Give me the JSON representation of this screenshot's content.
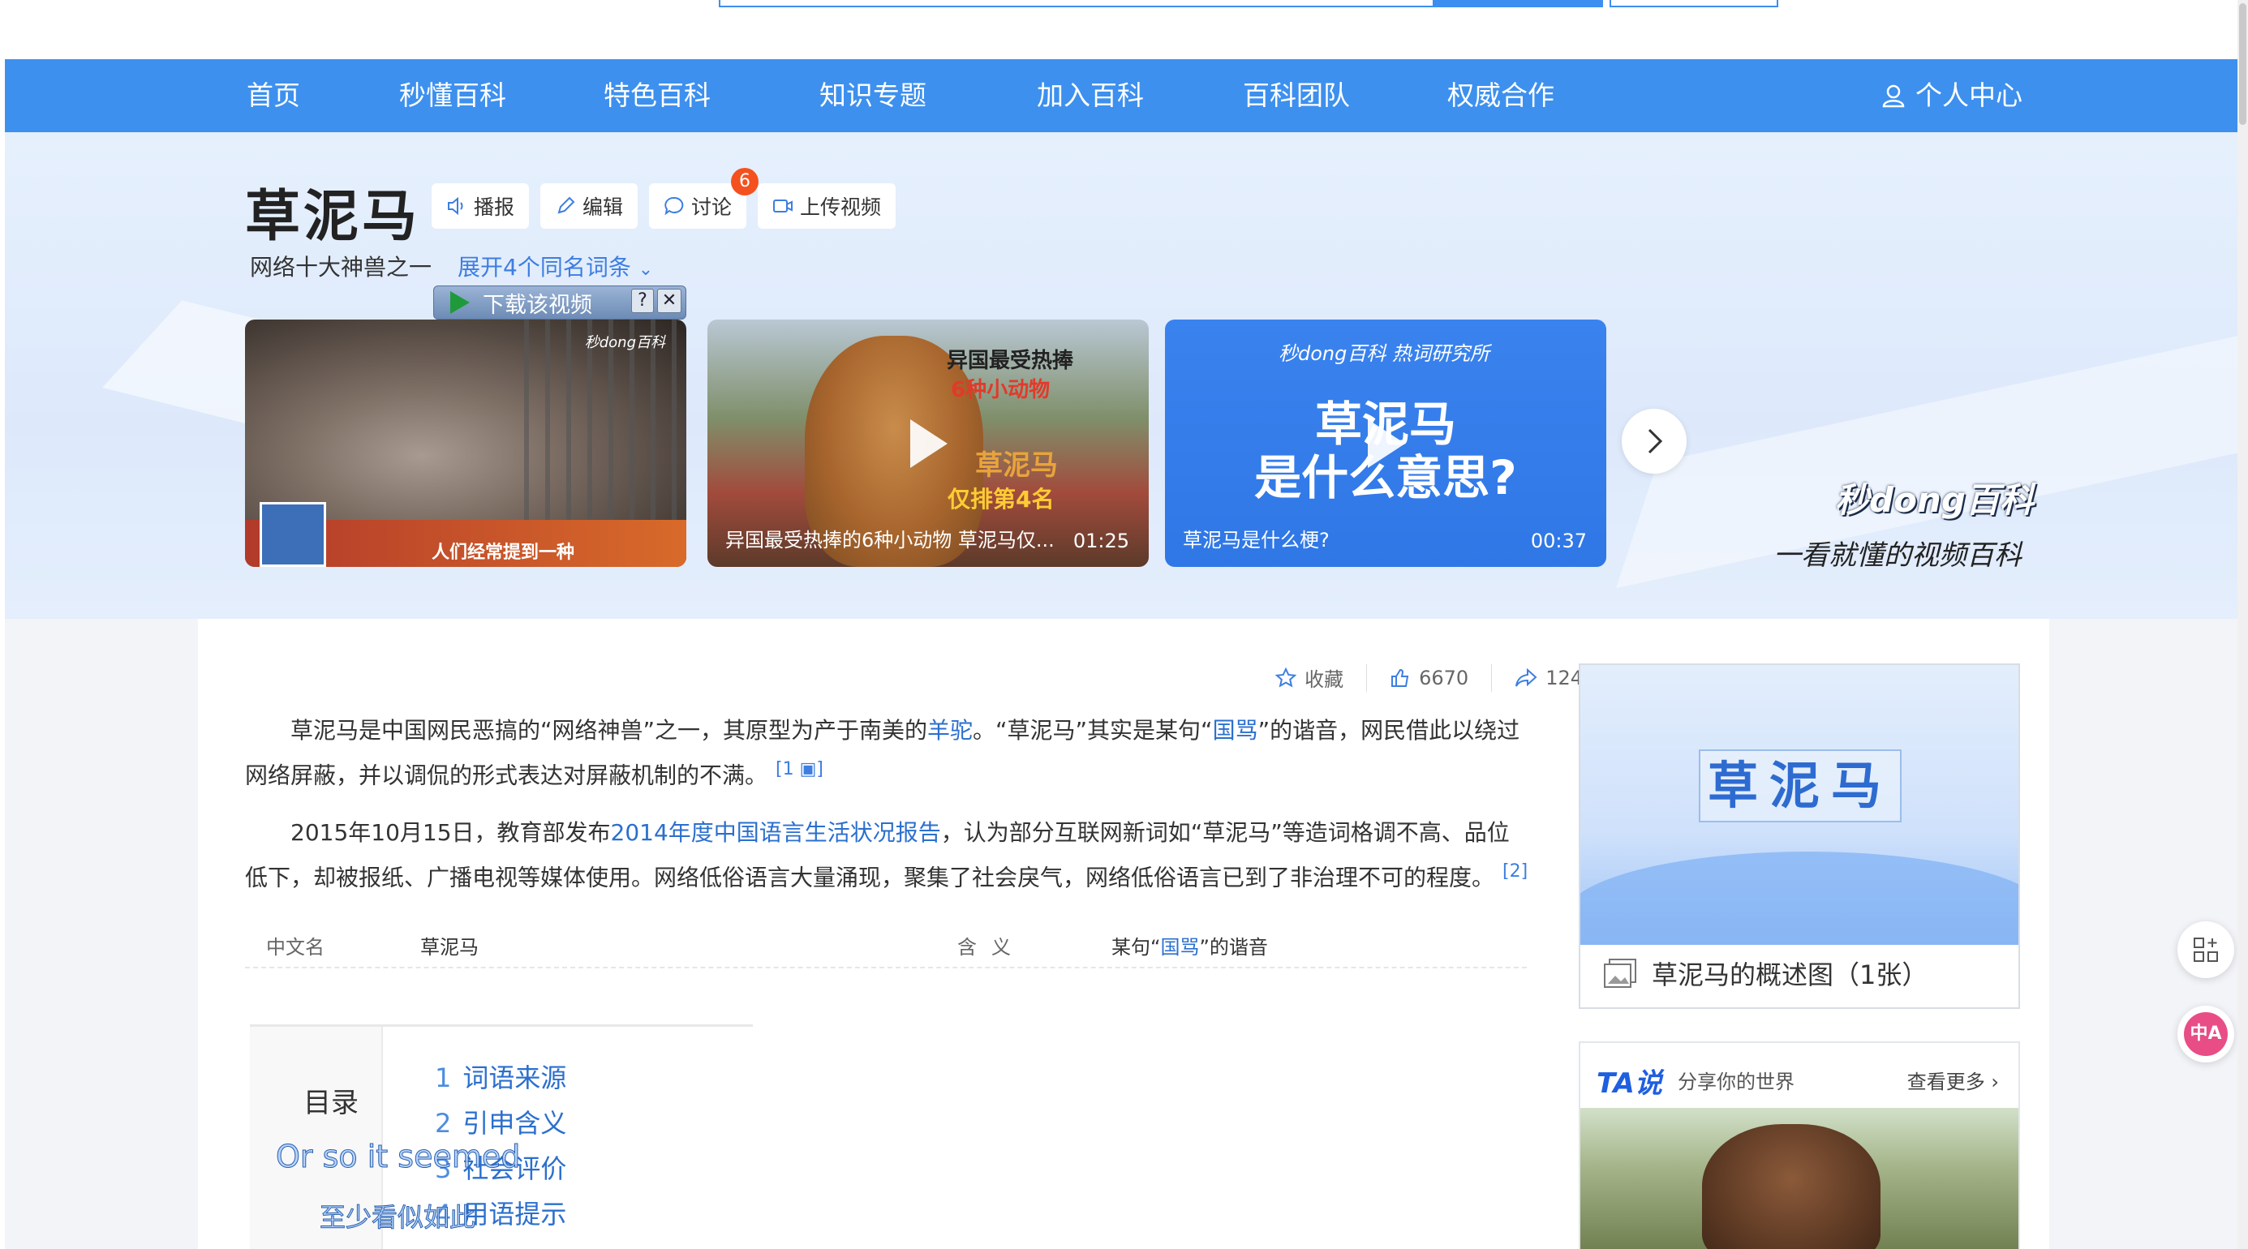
{
  "nav": {
    "items": [
      "首页",
      "秒懂百科",
      "特色百科",
      "知识专题",
      "加入百科",
      "百科团队",
      "权威合作"
    ],
    "user": "个人中心"
  },
  "entry": {
    "title": "草泥马",
    "buttons": {
      "broadcast": "播报",
      "edit": "编辑",
      "discuss": "讨论",
      "upload": "上传视频"
    },
    "discuss_badge": "6",
    "subtitle": "网络十大神兽之一",
    "expand": "展开4个同名词条"
  },
  "download_bar": {
    "label": "下载该视频",
    "help": "?",
    "close": "✕"
  },
  "videos": [
    {
      "caption": "",
      "overlay_text": "人们经常提到一种",
      "logo": "秒dong百科"
    },
    {
      "caption": "异国最受热捧的6种小动物 草泥马仅...",
      "duration": "01:25",
      "t1": "异国最受热捧",
      "t2": "6种小动物",
      "t3": "草泥马",
      "t4": "仅排第4名"
    },
    {
      "caption": "草泥马是什么梗?",
      "duration": "00:37",
      "brand": "秒dong百科  热词研究所",
      "t1": "草泥马",
      "t2": "是什么意思?"
    }
  ],
  "brand": {
    "logo": "秒dong百科",
    "slogan": "一看就懂的视频百科"
  },
  "actions": {
    "favorite": "收藏",
    "likes": "6670",
    "shares": "124"
  },
  "para1": {
    "t1": "草泥马是中国网民恶搞的“网络神兽”之一，其原型为产于南美的",
    "link1": "羊驼",
    "t2": "。“草泥马”其实是某句“",
    "link2": "国骂",
    "t3": "”的谐音，网民借此以绕过网络屏蔽，并以调侃的形式表达对屏蔽机制的不满。",
    "ref": "[1 ▣]"
  },
  "para2": {
    "t1": "2015年10月15日，教育部发布",
    "link1": "2014年度中国语言生活状况报告",
    "t2": "，认为部分互联网新词如“草泥马”等造词格调不高、品位低下，却被报纸、广播电视等媒体使用。网络低俗语言大量涌现，聚集了社会戾气，网络低俗语言已到了非治理不可的程度。",
    "ref": "[2]"
  },
  "infobox": {
    "k1": "中文名",
    "v1": "草泥马",
    "k2": "含义",
    "v2_pre": "某句“",
    "v2_link": "国骂",
    "v2_post": "”的谐音"
  },
  "toc": {
    "title": "目录",
    "items": [
      {
        "n": "1",
        "label": "词语来源"
      },
      {
        "n": "2",
        "label": "引申含义"
      },
      {
        "n": "3",
        "label": "社会评价"
      },
      {
        "n": "4",
        "label": "用语提示"
      }
    ]
  },
  "subtitles": {
    "en": "Or so it seemed",
    "zh": "至少看似如此"
  },
  "summary": {
    "title": "草泥马",
    "caption": "草泥马的概述图（1张）"
  },
  "tashuo": {
    "logo": "TA说",
    "sub": "分享你的世界",
    "more": "查看更多 ›"
  },
  "floating": {
    "translate": "中A"
  }
}
